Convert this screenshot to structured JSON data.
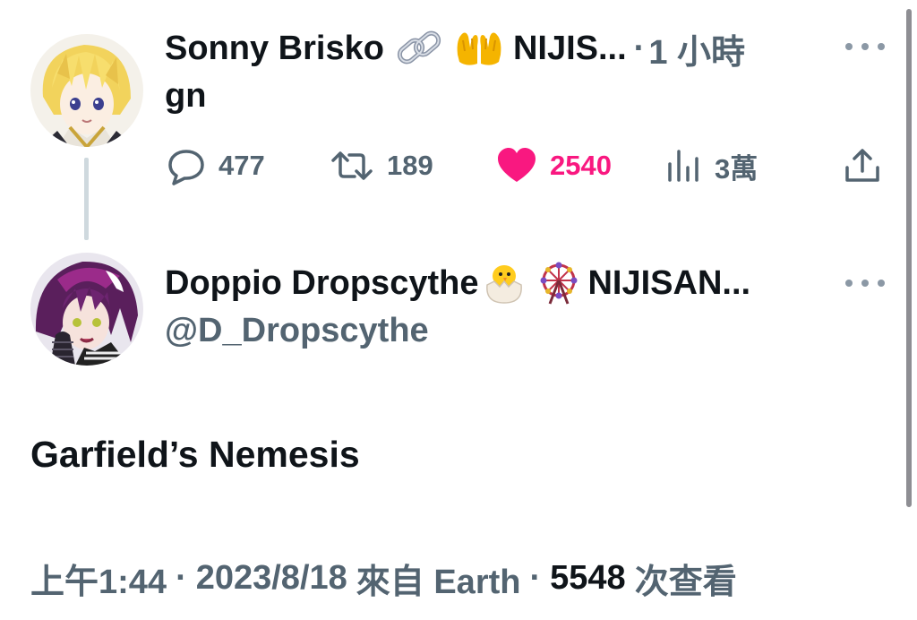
{
  "reply_tweet": {
    "author_name": "Sonny Brisko",
    "emojis": [
      "link-emoji",
      "open-palms-emoji"
    ],
    "author_name_trunc": "NIJIS...",
    "separator": "·",
    "time": "1 小時",
    "text": "gn",
    "actions": {
      "replies": "477",
      "retweets": "189",
      "likes": "2540",
      "views": "3萬"
    },
    "liked": true,
    "like_color": "#f91880"
  },
  "main_tweet": {
    "author_name": "Doppio Dropscythe",
    "emojis": [
      "hatching-chick-emoji",
      "ferris-wheel-emoji"
    ],
    "author_name_trunc": "NIJISAN...",
    "handle": "@D_Dropscythe",
    "text": "Garfield’s Nemesis",
    "meta": {
      "time": "上午1:44",
      "sep1": "·",
      "date": "2023/8/18",
      "source": "來自 Earth",
      "sep2": "·",
      "views_count": "5548",
      "views_label": "次查看"
    }
  },
  "colors": {
    "text_primary": "#0f1419",
    "text_secondary": "#536471",
    "like": "#f91880",
    "thread_line": "#cfd9de"
  }
}
